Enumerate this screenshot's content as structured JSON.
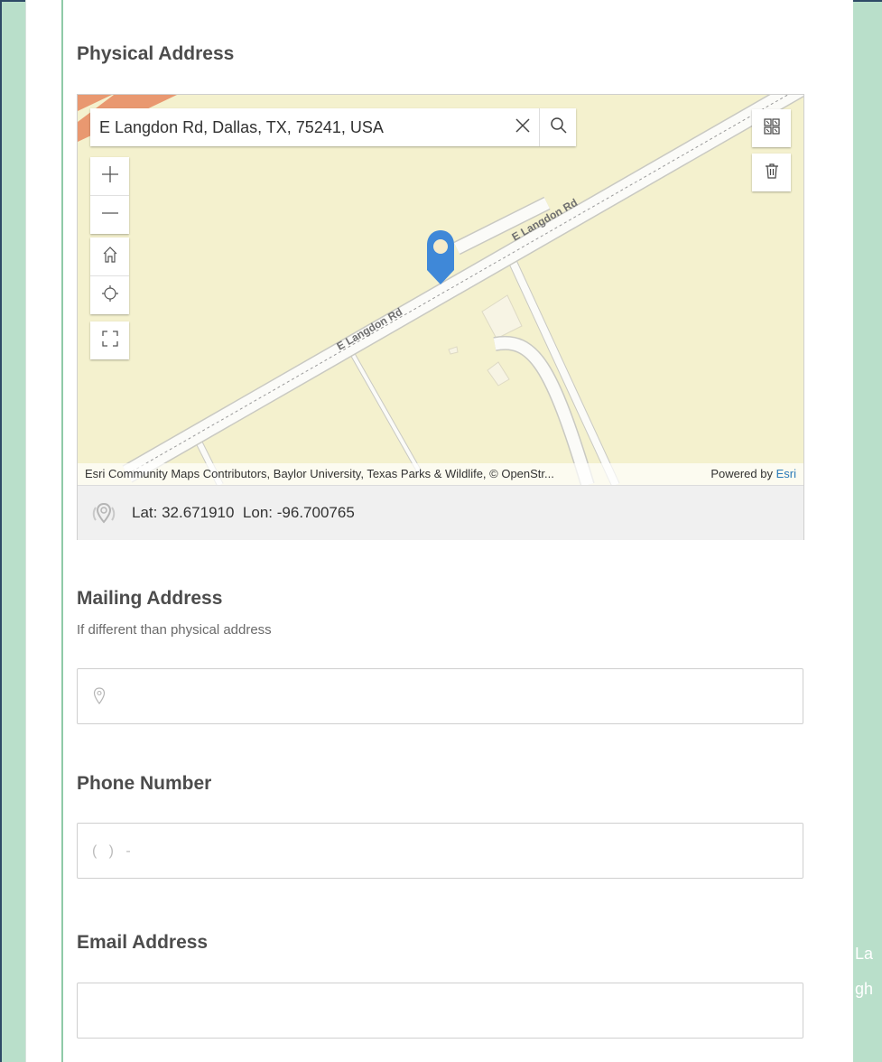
{
  "form": {
    "physical_address": {
      "title": "Physical Address",
      "search_value": "E Langdon Rd, Dallas, TX, 75241, USA",
      "road_labels": [
        "E Langdon Rd",
        "E Langdon Rd"
      ],
      "attribution": "Esri Community Maps Contributors, Baylor University, Texas Parks & Wildlife, © OpenStr...",
      "powered_by": "Powered by",
      "powered_by_link": "Esri",
      "coords": {
        "lat_label": "Lat:",
        "lat": "32.671910",
        "lon_label": "Lon:",
        "lon": "-96.700765"
      },
      "icons": {
        "clear": "close-icon",
        "search": "search-icon",
        "zoom_in": "plus-icon",
        "zoom_out": "minus-icon",
        "home": "home-icon",
        "locate": "locate-icon",
        "fullscreen": "fullscreen-icon",
        "basemap": "basemap-toggle-icon",
        "delete": "trash-icon",
        "pin": "map-pin-icon"
      }
    },
    "mailing_address": {
      "title": "Mailing Address",
      "description": "If different than physical address",
      "value": "",
      "icon": "location-icon"
    },
    "phone_number": {
      "title": "Phone Number",
      "placeholder": "(   )   -",
      "value": ""
    },
    "email_address": {
      "title": "Email Address",
      "value": ""
    }
  },
  "background_text": [
    "La",
    "gh"
  ],
  "colors": {
    "page_background": "#b9dfca",
    "card_accent": "#8fcaa8",
    "map_land": "#f4f1ce",
    "pin": "#3f88d8",
    "link": "#2a7ab8"
  }
}
